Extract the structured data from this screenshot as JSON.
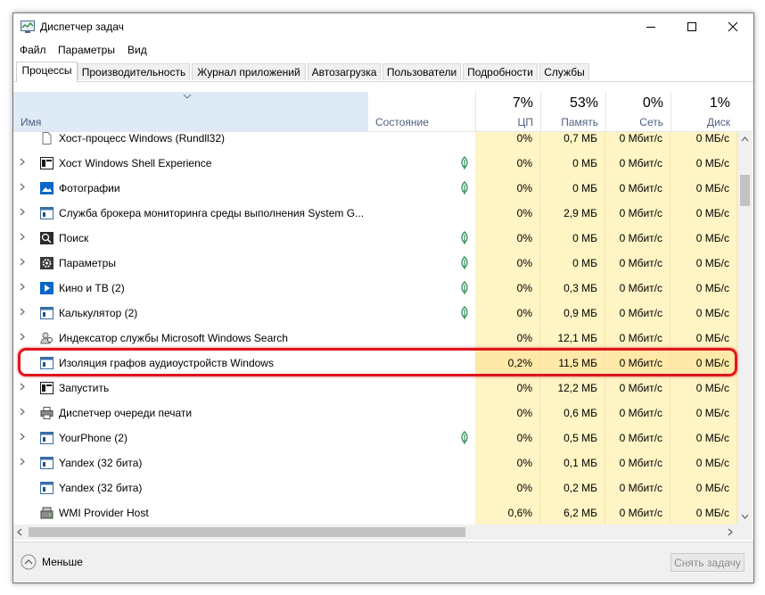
{
  "window": {
    "title": "Диспетчер задач",
    "minimize": "—",
    "maximize": "☐",
    "close": "✕"
  },
  "menu": {
    "file": "Файл",
    "options": "Параметры",
    "view": "Вид"
  },
  "tabs": [
    {
      "label": "Процессы",
      "active": true
    },
    {
      "label": "Производительность"
    },
    {
      "label": "Журнал приложений"
    },
    {
      "label": "Автозагрузка"
    },
    {
      "label": "Пользователи"
    },
    {
      "label": "Подробности"
    },
    {
      "label": "Службы"
    }
  ],
  "columns": {
    "name": "Имя",
    "status": "Состояние",
    "cpu": {
      "pct": "7%",
      "label": "ЦП"
    },
    "memory": {
      "pct": "53%",
      "label": "Память"
    },
    "network": {
      "pct": "0%",
      "label": "Сеть"
    },
    "disk": {
      "pct": "1%",
      "label": "Диск"
    }
  },
  "processes": [
    {
      "name": "Хост-процесс Windows (Rundll32)",
      "icon": "file-icon",
      "expand": false,
      "suspended": false,
      "cpu": "0%",
      "mem": "0,7 МБ",
      "net": "0 Мбит/с",
      "disk": "0 МБ/с"
    },
    {
      "name": "Хост Windows Shell Experience",
      "icon": "shell-icon",
      "expand": true,
      "suspended": true,
      "cpu": "0%",
      "mem": "0 МБ",
      "net": "0 Мбит/с",
      "disk": "0 МБ/с"
    },
    {
      "name": "Фотографии",
      "icon": "photos-icon",
      "expand": true,
      "suspended": true,
      "cpu": "0%",
      "mem": "0 МБ",
      "net": "0 Мбит/с",
      "disk": "0 МБ/с"
    },
    {
      "name": "Служба брокера мониторинга среды выполнения System G...",
      "icon": "window-icon",
      "expand": true,
      "suspended": false,
      "cpu": "0%",
      "mem": "2,9 МБ",
      "net": "0 Мбит/с",
      "disk": "0 МБ/с"
    },
    {
      "name": "Поиск",
      "icon": "search-icon",
      "expand": true,
      "suspended": true,
      "cpu": "0%",
      "mem": "0 МБ",
      "net": "0 Мбит/с",
      "disk": "0 МБ/с"
    },
    {
      "name": "Параметры",
      "icon": "gear-icon",
      "expand": true,
      "suspended": true,
      "cpu": "0%",
      "mem": "0 МБ",
      "net": "0 Мбит/с",
      "disk": "0 МБ/с"
    },
    {
      "name": "Кино и ТВ (2)",
      "icon": "movies-icon",
      "expand": true,
      "suspended": true,
      "cpu": "0%",
      "mem": "0,3 МБ",
      "net": "0 Мбит/с",
      "disk": "0 МБ/с"
    },
    {
      "name": "Калькулятор (2)",
      "icon": "window-icon",
      "expand": true,
      "suspended": true,
      "cpu": "0%",
      "mem": "0,9 МБ",
      "net": "0 Мбит/с",
      "disk": "0 МБ/с"
    },
    {
      "name": "Индексатор службы Microsoft Windows Search",
      "icon": "indexer-icon",
      "expand": true,
      "suspended": false,
      "cpu": "0%",
      "mem": "12,1 МБ",
      "net": "0 Мбит/с",
      "disk": "0 МБ/с"
    },
    {
      "name": "Изоляция графов аудиоустройств Windows",
      "icon": "window-icon",
      "expand": false,
      "suspended": false,
      "highlight": true,
      "cpu": "0,2%",
      "mem": "11,5 МБ",
      "net": "0 Мбит/с",
      "disk": "0 МБ/с"
    },
    {
      "name": "Запустить",
      "icon": "shell-icon",
      "expand": true,
      "suspended": false,
      "cpu": "0%",
      "mem": "12,2 МБ",
      "net": "0 Мбит/с",
      "disk": "0 МБ/с"
    },
    {
      "name": "Диспетчер очереди печати",
      "icon": "printer-icon",
      "expand": true,
      "suspended": false,
      "cpu": "0%",
      "mem": "0,6 МБ",
      "net": "0 Мбит/с",
      "disk": "0 МБ/с"
    },
    {
      "name": "YourPhone (2)",
      "icon": "window-icon",
      "expand": true,
      "suspended": true,
      "cpu": "0%",
      "mem": "0,5 МБ",
      "net": "0 Мбит/с",
      "disk": "0 МБ/с"
    },
    {
      "name": "Yandex (32 бита)",
      "icon": "window-icon",
      "expand": true,
      "suspended": false,
      "cpu": "0%",
      "mem": "0,1 МБ",
      "net": "0 Мбит/с",
      "disk": "0 МБ/с"
    },
    {
      "name": "Yandex (32 бита)",
      "icon": "window-icon",
      "expand": false,
      "suspended": false,
      "cpu": "0%",
      "mem": "0,2 МБ",
      "net": "0 Мбит/с",
      "disk": "0 МБ/с"
    },
    {
      "name": "WMI Provider Host",
      "icon": "wmi-icon",
      "expand": false,
      "suspended": false,
      "cpu": "0,6%",
      "mem": "6,2 МБ",
      "net": "0 Мбит/с",
      "disk": "0 МБ/с"
    }
  ],
  "footer": {
    "less": "Меньше",
    "end_task": "Снять задачу"
  }
}
